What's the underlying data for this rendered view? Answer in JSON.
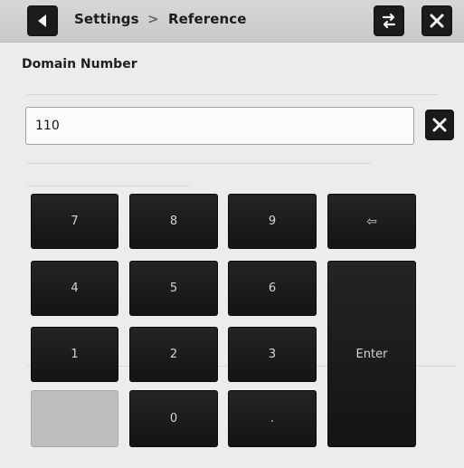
{
  "header": {
    "breadcrumb": {
      "section": "Settings",
      "separator": ">",
      "page": "Reference"
    },
    "icons": {
      "back": "back-arrow-icon",
      "swap": "swap-icon",
      "close": "close-icon"
    }
  },
  "page": {
    "title": "Domain Number"
  },
  "input": {
    "value": "110",
    "clear_icon": "close-icon"
  },
  "keypad": {
    "keys": {
      "k7": "7",
      "k8": "8",
      "k9": "9",
      "backspace": "⇦",
      "k4": "4",
      "k5": "5",
      "k6": "6",
      "k1": "1",
      "k2": "2",
      "k3": "3",
      "enter": "Enter",
      "negative": "-",
      "k0": "0",
      "decimal": "."
    }
  },
  "background_text": {
    "line_1": "",
    "line_2": ""
  },
  "colors": {
    "header_bg": "#cfcfcf",
    "page_bg": "#ececec",
    "key_bg": "#1a1a1a",
    "key_text": "#d5d5d5",
    "disabled_key_bg": "#bdbdbd",
    "button_dark": "#1a1a1a"
  }
}
